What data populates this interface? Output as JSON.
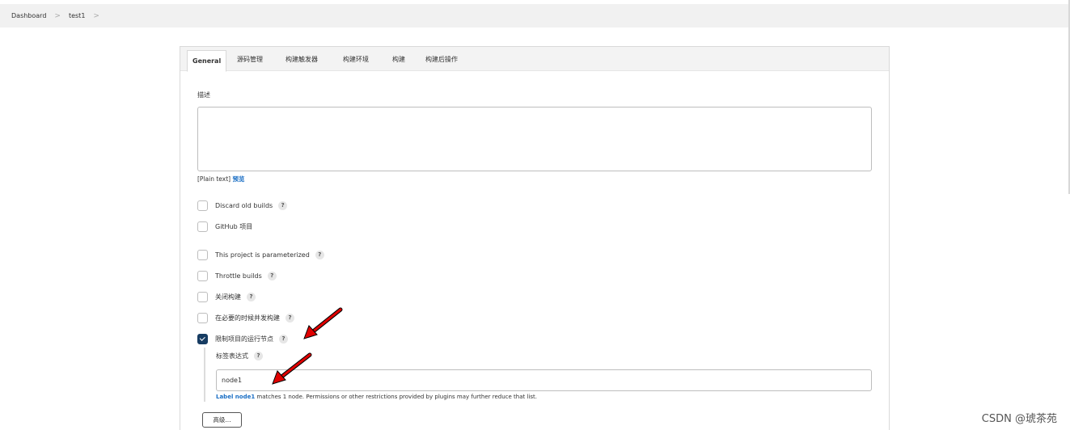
{
  "breadcrumb": {
    "items": [
      "Dashboard",
      "test1"
    ],
    "separator": ">"
  },
  "tabs": [
    {
      "label": "General",
      "active": true
    },
    {
      "label": "源码管理"
    },
    {
      "label": "构建触发器"
    },
    {
      "label": "构建环境"
    },
    {
      "label": "构建"
    },
    {
      "label": "构建后操作"
    }
  ],
  "description": {
    "label": "描述",
    "value": "",
    "format_prefix": "[Plain text]",
    "preview_link": "预览"
  },
  "options": [
    {
      "label": "Discard old builds",
      "checked": false
    },
    {
      "label": "GitHub 项目",
      "checked": false,
      "help": false
    },
    {
      "label": "This project is parameterized",
      "checked": false
    },
    {
      "label": "Throttle builds",
      "checked": false
    },
    {
      "label": "关闭构建",
      "checked": false
    },
    {
      "label": "在必要的时候并发构建",
      "checked": false
    },
    {
      "label": "限制项目的运行节点",
      "checked": true
    }
  ],
  "help_glyph": "?",
  "label_expression": {
    "label": "标签表达式",
    "value": "node1",
    "match_link": "Label node1",
    "match_text": " matches 1 node. Permissions or other restrictions provided by plugins may further reduce that list."
  },
  "advanced_button": "高级...",
  "watermark": "CSDN @琥茶苑",
  "colors": {
    "checked": "#173c62",
    "link": "#1a6ec4",
    "arrow": "#e10000"
  },
  "icons": [
    "chevron-right-icon",
    "help-icon",
    "checkmark-icon",
    "red-arrow-annotation"
  ]
}
